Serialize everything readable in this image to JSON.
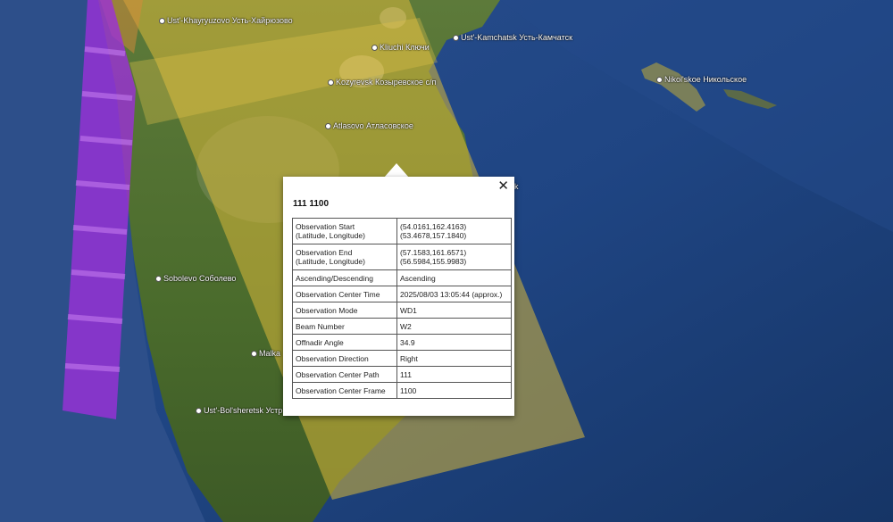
{
  "map": {
    "places": [
      {
        "name": "Ust'-Khayryuzovo Усть-Хайрюзово"
      },
      {
        "name": "Kliuchi Ключи"
      },
      {
        "name": "Ust'-Kamchatsk Усть-Камчатск"
      },
      {
        "name": "Nikol'skoe Никольское"
      },
      {
        "name": "Kozyrevsk Козыревское с/п"
      },
      {
        "name": "Atlasovo Атласовское"
      },
      {
        "name": "Sobolevo Соболево"
      },
      {
        "name": "Malka"
      },
      {
        "name": "Ust'-Bol'sheretsk Устр"
      },
      {
        "name": "k"
      }
    ]
  },
  "popup": {
    "title": "111 1100",
    "close_symbol": "✕",
    "rows": [
      {
        "key": "Observation Start\n(Latitude, Longitude)",
        "value": "(54.0161,162.4163)\n(53.4678,157.1840)"
      },
      {
        "key": "Observation End\n(Latitude, Longitude)",
        "value": "(57.1583,161.6571)\n(56.5984,155.9983)"
      },
      {
        "key": "Ascending/Descending",
        "value": "Ascending"
      },
      {
        "key": "Observation Center Time",
        "value": "2025/08/03 13:05:44 (approx.)"
      },
      {
        "key": "Observation Mode",
        "value": "WD1"
      },
      {
        "key": "Beam Number",
        "value": "W2"
      },
      {
        "key": "Offnadir Angle",
        "value": "34.9"
      },
      {
        "key": "Observation Direction",
        "value": "Right"
      },
      {
        "key": "Observation Center Path",
        "value": "111"
      },
      {
        "key": "Observation Center Frame",
        "value": "1100"
      }
    ]
  },
  "colors": {
    "ocean": "#1d3f7a",
    "land": "#4a6b2f",
    "swath_yellow": "#d8b83a",
    "swath_purple": "#9b2fd8"
  }
}
